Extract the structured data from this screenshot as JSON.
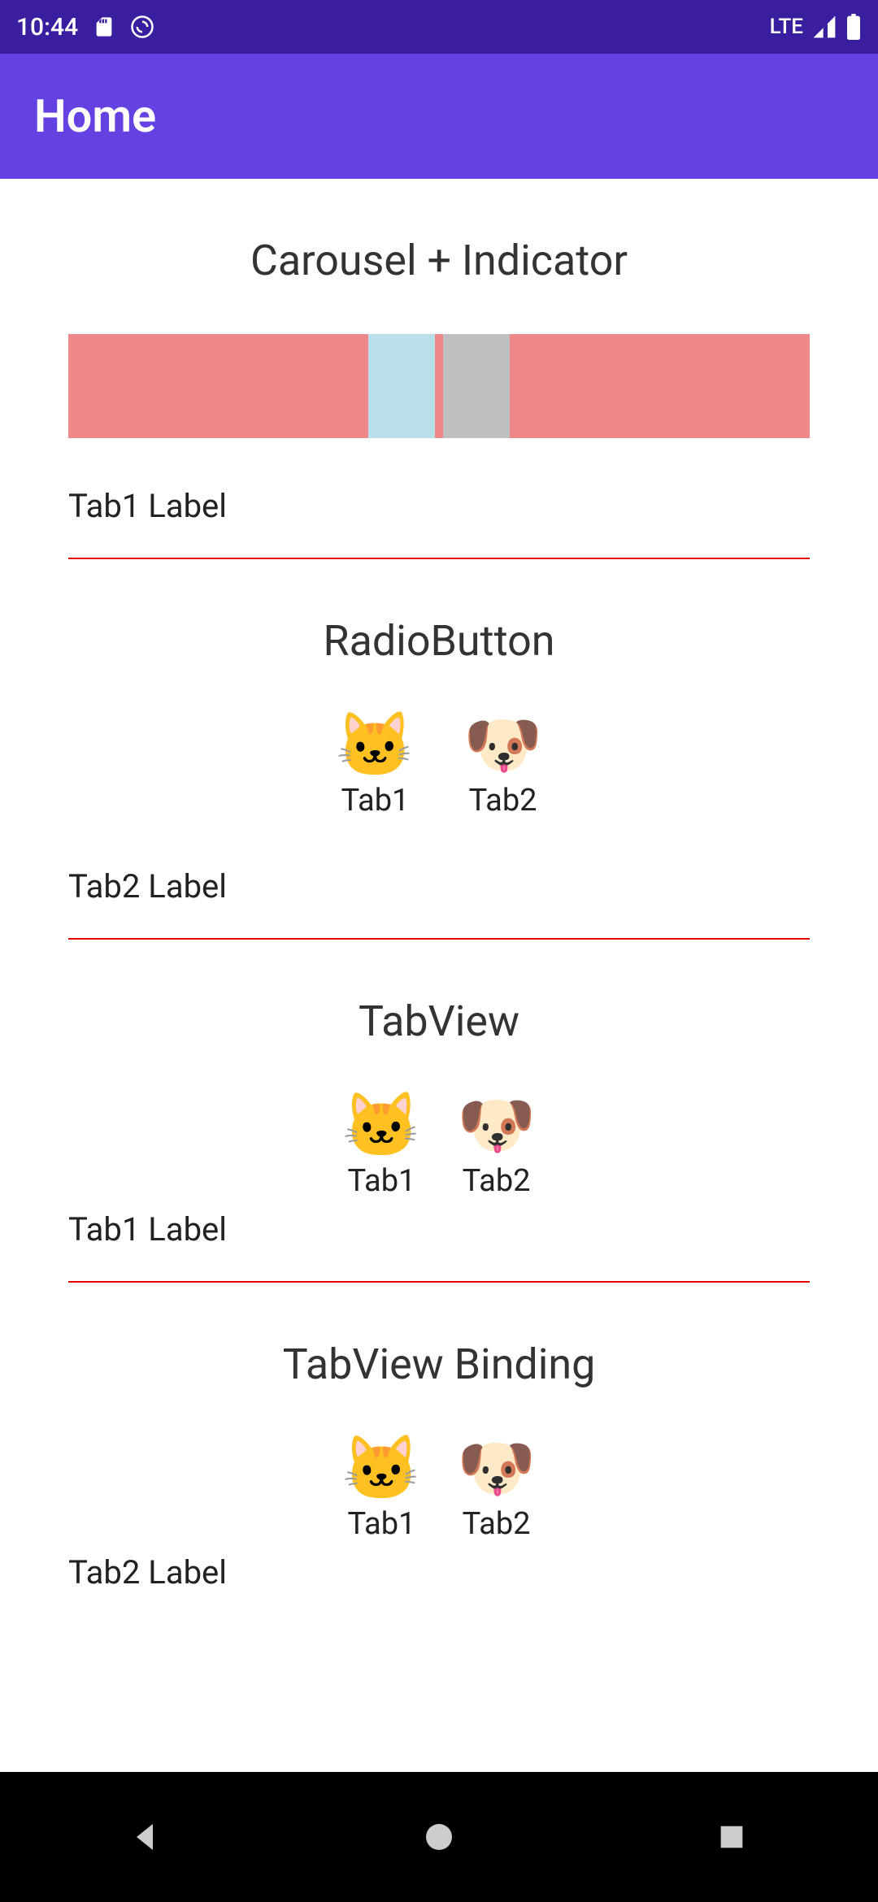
{
  "status": {
    "time": "10:44",
    "network": "LTE"
  },
  "app": {
    "title": "Home"
  },
  "sections": {
    "carousel": {
      "title": "Carousel + Indicator",
      "indicator_segments": [
        {
          "color": "#ef8888",
          "flex": 36
        },
        {
          "color": "#b9dfea",
          "flex": 8
        },
        {
          "color": "#ef8888",
          "flex": 1
        },
        {
          "color": "#bfbfbf",
          "flex": 8
        },
        {
          "color": "#ef8888",
          "flex": 36
        }
      ],
      "current_label": "Tab1 Label"
    },
    "radio": {
      "title": "RadioButton",
      "tabs": [
        {
          "icon": "🐱",
          "label": "Tab1"
        },
        {
          "icon": "🐶",
          "label": "Tab2"
        }
      ],
      "current_label": "Tab2 Label"
    },
    "tabview": {
      "title": "TabView",
      "tabs": [
        {
          "icon": "🐱",
          "label": "Tab1"
        },
        {
          "icon": "🐶",
          "label": "Tab2"
        }
      ],
      "current_label": "Tab1 Label"
    },
    "tabview_binding": {
      "title": "TabView Binding",
      "tabs": [
        {
          "icon": "🐱",
          "label": "Tab1"
        },
        {
          "icon": "🐶",
          "label": "Tab2"
        }
      ],
      "current_label": "Tab2 Label"
    }
  }
}
